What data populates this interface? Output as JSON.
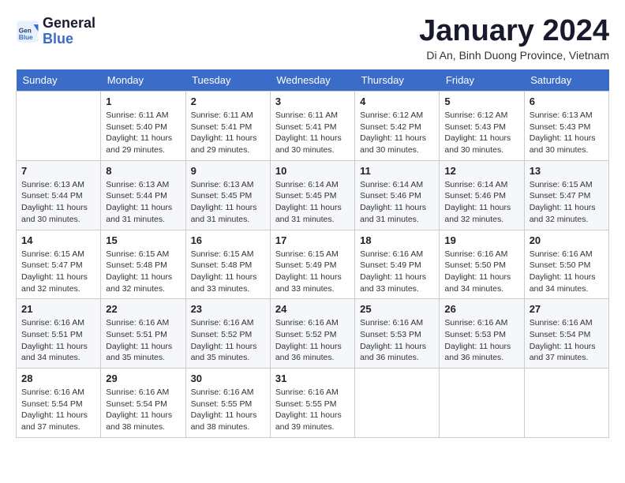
{
  "header": {
    "logo_line1": "General",
    "logo_line2": "Blue",
    "month": "January 2024",
    "location": "Di An, Binh Duong Province, Vietnam"
  },
  "weekdays": [
    "Sunday",
    "Monday",
    "Tuesday",
    "Wednesday",
    "Thursday",
    "Friday",
    "Saturday"
  ],
  "weeks": [
    [
      {
        "day": "",
        "info": ""
      },
      {
        "day": "1",
        "info": "Sunrise: 6:11 AM\nSunset: 5:40 PM\nDaylight: 11 hours\nand 29 minutes."
      },
      {
        "day": "2",
        "info": "Sunrise: 6:11 AM\nSunset: 5:41 PM\nDaylight: 11 hours\nand 29 minutes."
      },
      {
        "day": "3",
        "info": "Sunrise: 6:11 AM\nSunset: 5:41 PM\nDaylight: 11 hours\nand 30 minutes."
      },
      {
        "day": "4",
        "info": "Sunrise: 6:12 AM\nSunset: 5:42 PM\nDaylight: 11 hours\nand 30 minutes."
      },
      {
        "day": "5",
        "info": "Sunrise: 6:12 AM\nSunset: 5:43 PM\nDaylight: 11 hours\nand 30 minutes."
      },
      {
        "day": "6",
        "info": "Sunrise: 6:13 AM\nSunset: 5:43 PM\nDaylight: 11 hours\nand 30 minutes."
      }
    ],
    [
      {
        "day": "7",
        "info": "Sunrise: 6:13 AM\nSunset: 5:44 PM\nDaylight: 11 hours\nand 30 minutes."
      },
      {
        "day": "8",
        "info": "Sunrise: 6:13 AM\nSunset: 5:44 PM\nDaylight: 11 hours\nand 31 minutes."
      },
      {
        "day": "9",
        "info": "Sunrise: 6:13 AM\nSunset: 5:45 PM\nDaylight: 11 hours\nand 31 minutes."
      },
      {
        "day": "10",
        "info": "Sunrise: 6:14 AM\nSunset: 5:45 PM\nDaylight: 11 hours\nand 31 minutes."
      },
      {
        "day": "11",
        "info": "Sunrise: 6:14 AM\nSunset: 5:46 PM\nDaylight: 11 hours\nand 31 minutes."
      },
      {
        "day": "12",
        "info": "Sunrise: 6:14 AM\nSunset: 5:46 PM\nDaylight: 11 hours\nand 32 minutes."
      },
      {
        "day": "13",
        "info": "Sunrise: 6:15 AM\nSunset: 5:47 PM\nDaylight: 11 hours\nand 32 minutes."
      }
    ],
    [
      {
        "day": "14",
        "info": "Sunrise: 6:15 AM\nSunset: 5:47 PM\nDaylight: 11 hours\nand 32 minutes."
      },
      {
        "day": "15",
        "info": "Sunrise: 6:15 AM\nSunset: 5:48 PM\nDaylight: 11 hours\nand 32 minutes."
      },
      {
        "day": "16",
        "info": "Sunrise: 6:15 AM\nSunset: 5:48 PM\nDaylight: 11 hours\nand 33 minutes."
      },
      {
        "day": "17",
        "info": "Sunrise: 6:15 AM\nSunset: 5:49 PM\nDaylight: 11 hours\nand 33 minutes."
      },
      {
        "day": "18",
        "info": "Sunrise: 6:16 AM\nSunset: 5:49 PM\nDaylight: 11 hours\nand 33 minutes."
      },
      {
        "day": "19",
        "info": "Sunrise: 6:16 AM\nSunset: 5:50 PM\nDaylight: 11 hours\nand 34 minutes."
      },
      {
        "day": "20",
        "info": "Sunrise: 6:16 AM\nSunset: 5:50 PM\nDaylight: 11 hours\nand 34 minutes."
      }
    ],
    [
      {
        "day": "21",
        "info": "Sunrise: 6:16 AM\nSunset: 5:51 PM\nDaylight: 11 hours\nand 34 minutes."
      },
      {
        "day": "22",
        "info": "Sunrise: 6:16 AM\nSunset: 5:51 PM\nDaylight: 11 hours\nand 35 minutes."
      },
      {
        "day": "23",
        "info": "Sunrise: 6:16 AM\nSunset: 5:52 PM\nDaylight: 11 hours\nand 35 minutes."
      },
      {
        "day": "24",
        "info": "Sunrise: 6:16 AM\nSunset: 5:52 PM\nDaylight: 11 hours\nand 36 minutes."
      },
      {
        "day": "25",
        "info": "Sunrise: 6:16 AM\nSunset: 5:53 PM\nDaylight: 11 hours\nand 36 minutes."
      },
      {
        "day": "26",
        "info": "Sunrise: 6:16 AM\nSunset: 5:53 PM\nDaylight: 11 hours\nand 36 minutes."
      },
      {
        "day": "27",
        "info": "Sunrise: 6:16 AM\nSunset: 5:54 PM\nDaylight: 11 hours\nand 37 minutes."
      }
    ],
    [
      {
        "day": "28",
        "info": "Sunrise: 6:16 AM\nSunset: 5:54 PM\nDaylight: 11 hours\nand 37 minutes."
      },
      {
        "day": "29",
        "info": "Sunrise: 6:16 AM\nSunset: 5:54 PM\nDaylight: 11 hours\nand 38 minutes."
      },
      {
        "day": "30",
        "info": "Sunrise: 6:16 AM\nSunset: 5:55 PM\nDaylight: 11 hours\nand 38 minutes."
      },
      {
        "day": "31",
        "info": "Sunrise: 6:16 AM\nSunset: 5:55 PM\nDaylight: 11 hours\nand 39 minutes."
      },
      {
        "day": "",
        "info": ""
      },
      {
        "day": "",
        "info": ""
      },
      {
        "day": "",
        "info": ""
      }
    ]
  ]
}
